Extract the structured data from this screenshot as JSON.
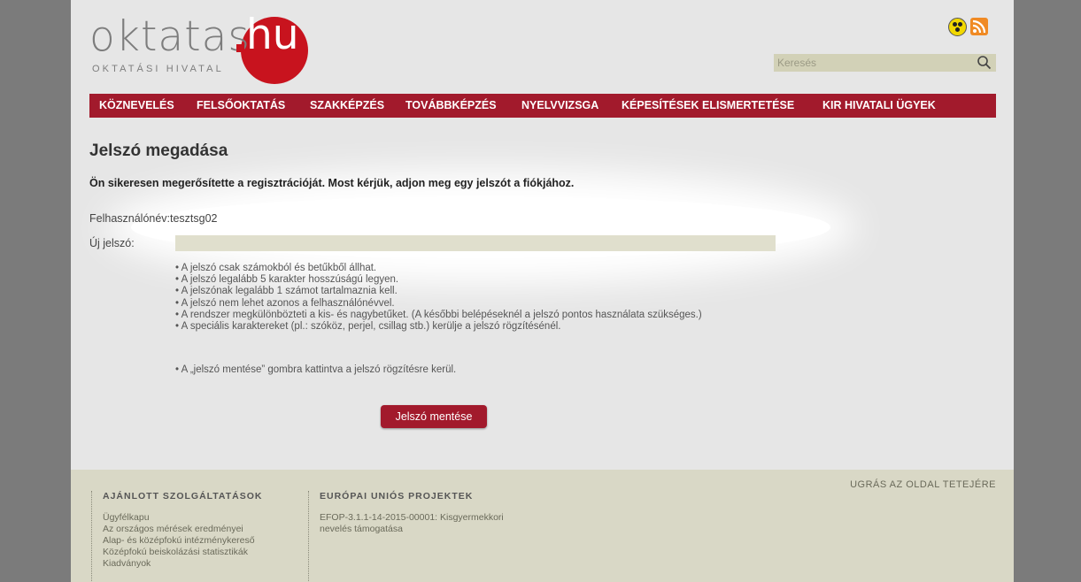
{
  "header": {
    "logo_word": "oktatas",
    "logo_hu": "hu",
    "logo_subtitle": "OKTATÁSI HIVATAL",
    "search_placeholder": "Keresés",
    "icons": [
      "accessibility-icon",
      "rss-icon",
      "search-icon"
    ]
  },
  "nav": {
    "items": [
      "KÖZNEVELÉS",
      "FELSŐOKTATÁS",
      "SZAKKÉPZÉS",
      "TOVÁBBKÉPZÉS",
      "NYELVVIZSGA",
      "KÉPESÍTÉSEK ELISMERTETÉSE",
      "KIR HIVATALI ÜGYEK"
    ]
  },
  "main": {
    "title": "Jelszó megadása",
    "intro": "Ön sikeresen megerősítette a regisztrációját. Most kérjük, adjon meg egy jelszót a fiókjához.",
    "username_label": "Felhasználónév:",
    "username_value": "tesztsg02",
    "password_label": "Új jelszó:",
    "password_value": "",
    "rules": [
      "• A jelszó csak számokból és betűkből állhat.",
      "• A jelszó legalább 5 karakter hosszúságú legyen.",
      "• A jelszónak legalább 1 számot tartalmaznia kell.",
      "• A jelszó nem lehet azonos a felhasználónévvel.",
      "• A rendszer megkülönbözteti a kis- és nagybetűket. (A későbbi belépéseknél a jelszó pontos használata szükséges.)",
      "• A speciális karaktereket (pl.: szóköz, perjel, csillag stb.) kerülje a jelszó rögzítésénél."
    ],
    "save_note": "• A „jelszó mentése” gombra kattintva a jelszó rögzítésre kerül.",
    "save_button": "Jelszó mentése"
  },
  "footer": {
    "back_to_top": "UGRÁS AZ OLDAL TETEJÉRE",
    "col1": {
      "title": "AJÁNLOTT SZOLGÁLTATÁSOK",
      "links": [
        "Ügyfélkapu",
        "Az országos mérések eredményei",
        "Alap- és középfokú intézménykereső",
        "Középfokú beiskolázási statisztikák",
        "Kiadványok"
      ]
    },
    "col2": {
      "title": "EURÓPAI UNIÓS PROJEKTEK",
      "text": "EFOP-3.1.1-14-2015-00001: Kisgyermekkori nevelés támogatása"
    }
  },
  "colors": {
    "brand_red": "#a21a2c",
    "logo_red": "#c8131e",
    "page_bg": "#e6e6e6",
    "outer_bg": "#7b7b7b",
    "footer_bg": "#d9d8c6",
    "input_bg": "#e0dfcd"
  }
}
